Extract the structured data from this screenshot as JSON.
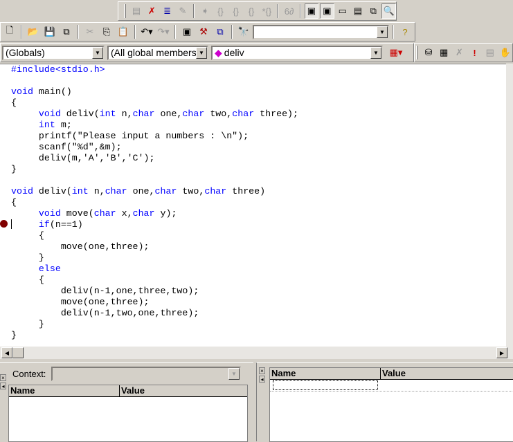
{
  "toolbars": {
    "debug": [
      "go-to-code-icon",
      "remove-breakpoint-icon",
      "build-stop-icon",
      "apply-code-changes-icon",
      "show-next-statement-icon",
      "step-into-icon",
      "step-over-icon",
      "step-out-icon",
      "run-to-cursor-icon",
      "quickwatch-icon",
      "watch-window-icon",
      "variables-window-icon",
      "registers-window-icon",
      "memory-window-icon",
      "call-stack-icon",
      "disassembly-icon"
    ],
    "find_value": "",
    "wizard": {
      "class": "(Globals)",
      "filter": "(All global members",
      "member": "deliv"
    }
  },
  "code": [
    [
      [
        "#include<stdio.h>",
        "kw"
      ]
    ],
    [],
    [
      [
        "void",
        "kw"
      ],
      [
        " main()",
        ""
      ]
    ],
    [
      [
        "{",
        ""
      ]
    ],
    [
      [
        "     ",
        ""
      ],
      [
        "void",
        "kw"
      ],
      [
        " deliv(",
        ""
      ],
      [
        "int",
        "kw"
      ],
      [
        " n,",
        ""
      ],
      [
        "char",
        "kw"
      ],
      [
        " one,",
        ""
      ],
      [
        "char",
        "kw"
      ],
      [
        " two,",
        ""
      ],
      [
        "char",
        "kw"
      ],
      [
        " three);",
        ""
      ]
    ],
    [
      [
        "     ",
        ""
      ],
      [
        "int",
        "kw"
      ],
      [
        " m;",
        ""
      ]
    ],
    [
      [
        "     printf(\"Please input a numbers : \\n\");",
        ""
      ]
    ],
    [
      [
        "     scanf(\"%d\",&m);",
        ""
      ]
    ],
    [
      [
        "     deliv(m,'A','B','C');",
        ""
      ]
    ],
    [
      [
        "}",
        ""
      ]
    ],
    [],
    [
      [
        "void",
        "kw"
      ],
      [
        " deliv(",
        ""
      ],
      [
        "int",
        "kw"
      ],
      [
        " n,",
        ""
      ],
      [
        "char",
        "kw"
      ],
      [
        " one,",
        ""
      ],
      [
        "char",
        "kw"
      ],
      [
        " two,",
        ""
      ],
      [
        "char",
        "kw"
      ],
      [
        " three)",
        ""
      ]
    ],
    [
      [
        "{",
        ""
      ]
    ],
    [
      [
        "     ",
        ""
      ],
      [
        "void",
        "kw"
      ],
      [
        " move(",
        ""
      ],
      [
        "char",
        "kw"
      ],
      [
        " x,",
        ""
      ],
      [
        "char",
        "kw"
      ],
      [
        " y);",
        ""
      ]
    ],
    [
      [
        "     ",
        ""
      ],
      [
        "if",
        "kw"
      ],
      [
        "(n==1)",
        ""
      ]
    ],
    [
      [
        "     {",
        ""
      ]
    ],
    [
      [
        "         move(one,three);",
        ""
      ]
    ],
    [
      [
        "     }",
        ""
      ]
    ],
    [
      [
        "     ",
        ""
      ],
      [
        "else",
        "kw"
      ]
    ],
    [
      [
        "     {",
        ""
      ]
    ],
    [
      [
        "         deliv(n-1,one,three,two);",
        ""
      ]
    ],
    [
      [
        "         move(one,three);",
        ""
      ]
    ],
    [
      [
        "         deliv(n-1,two,one,three);",
        ""
      ]
    ],
    [
      [
        "     }",
        ""
      ]
    ],
    [
      [
        "}",
        ""
      ]
    ]
  ],
  "variables": {
    "context_label": "Context:",
    "context_value": "",
    "col_name": "Name",
    "col_value": "Value"
  },
  "watch": {
    "col_name": "Name",
    "col_value": "Value"
  },
  "colors": {
    "keyword": "#0000ff",
    "breakpoint": "#800000"
  }
}
